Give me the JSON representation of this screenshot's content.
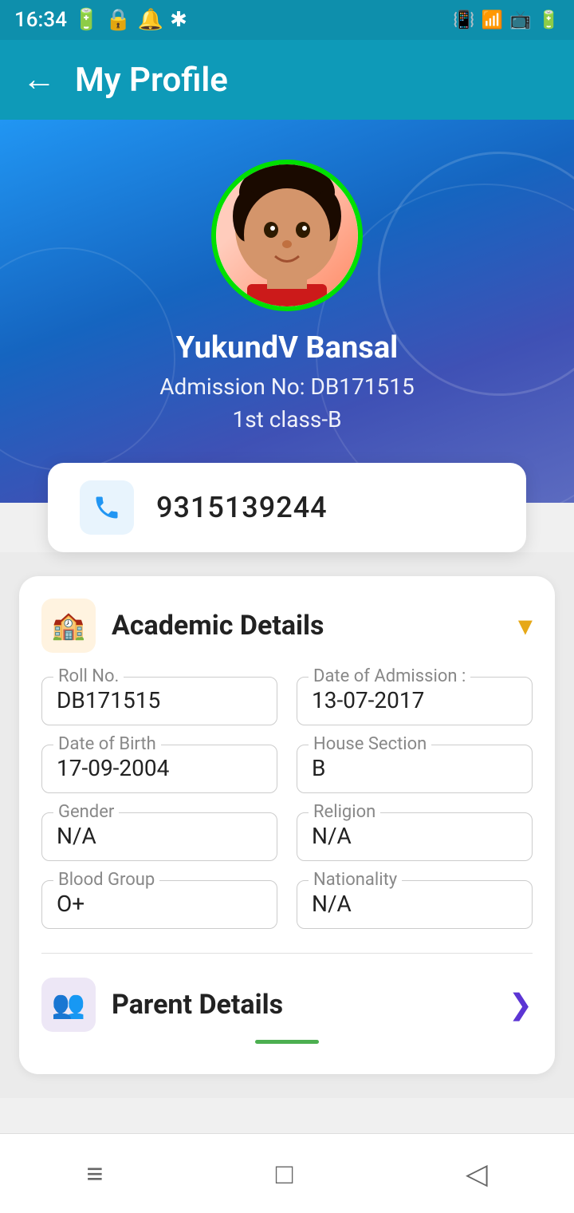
{
  "statusBar": {
    "time": "16:34",
    "leftIcons": [
      "sim",
      "lock",
      "notification",
      "bluetooth"
    ],
    "rightIcons": [
      "vibrate",
      "wifi",
      "cast",
      "battery"
    ]
  },
  "topNav": {
    "backLabel": "←",
    "title": "My Profile"
  },
  "hero": {
    "avatarEmoji": "👦",
    "studentName": "YukundV Bansal",
    "admissionLabel": "Admission No: DB171515",
    "classLabel": "1st class-B"
  },
  "phoneCard": {
    "phoneNumber": "9315139244"
  },
  "academicSection": {
    "iconEmoji": "🏫",
    "title": "Academic Details",
    "chevron": "▾",
    "fields": [
      {
        "label": "Roll No.",
        "value": "DB171515"
      },
      {
        "label": "Date of Admission :",
        "value": "13-07-2017"
      },
      {
        "label": "Date of Birth",
        "value": "17-09-2004"
      },
      {
        "label": "House Section",
        "value": "B"
      },
      {
        "label": "Gender",
        "value": "N/A"
      },
      {
        "label": "Religion",
        "value": "N/A"
      },
      {
        "label": "Blood Group",
        "value": "O+"
      },
      {
        "label": "Nationality",
        "value": "N/A"
      }
    ]
  },
  "parentSection": {
    "iconEmoji": "👥",
    "title": "Parent Details",
    "chevron": "❯"
  },
  "bottomNav": {
    "icons": [
      "≡",
      "□",
      "◁"
    ]
  }
}
